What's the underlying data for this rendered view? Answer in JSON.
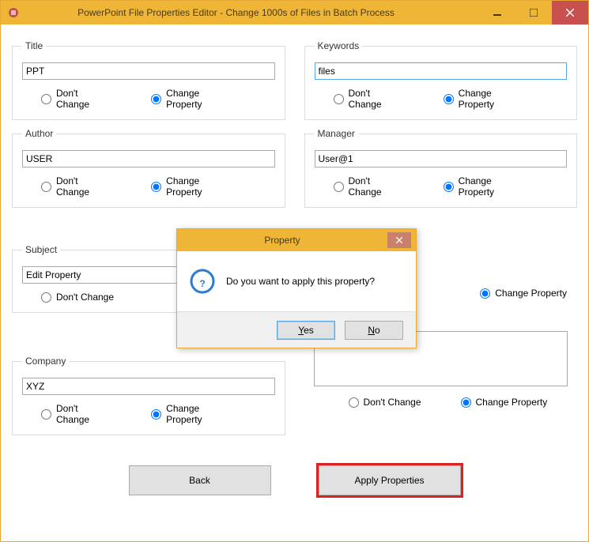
{
  "window": {
    "title": "PowerPoint File Properties Editor - Change 1000s of Files in Batch Process"
  },
  "labels": {
    "dont_change": "Don't Change",
    "change_property": "Change Property"
  },
  "groups": {
    "title": {
      "legend": "Title",
      "value": "PPT",
      "selected": "change"
    },
    "author": {
      "legend": "Author",
      "value": "USER",
      "selected": "change"
    },
    "subject": {
      "legend": "Subject",
      "value": "Edit Property",
      "selected": "none"
    },
    "company": {
      "legend": "Company",
      "value": "XYZ",
      "selected": "change"
    },
    "keywords": {
      "legend": "Keywords",
      "value": "files",
      "selected": "change"
    },
    "manager": {
      "legend": "Manager",
      "value": "User@1",
      "selected": "change"
    },
    "comments": {
      "legend": "",
      "value": "@123",
      "selected": "change"
    }
  },
  "footer": {
    "back": "Back",
    "apply": "Apply Properties"
  },
  "dialog": {
    "title": "Property",
    "message": "Do you want to apply this property?",
    "yes": "Yes",
    "no": "No"
  }
}
